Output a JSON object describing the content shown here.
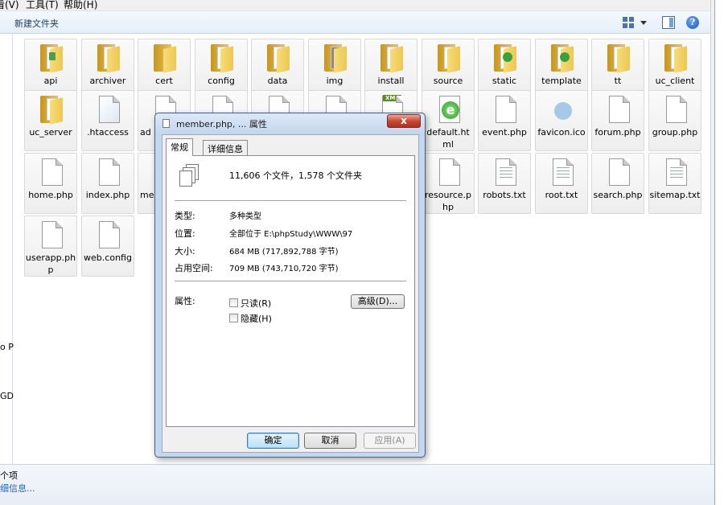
{
  "menubar": {
    "items": [
      {
        "label": "看(V)"
      },
      {
        "label": "工具(T)"
      },
      {
        "label": "帮助(H)"
      }
    ]
  },
  "toolbar": {
    "new_folder_label": "新建文件夹",
    "icons": [
      "views-icon",
      "preview-pane-icon",
      "help-icon"
    ],
    "help_glyph": "?"
  },
  "nav_fragments": [
    "o P",
    "GDL"
  ],
  "files": [
    {
      "name": "api",
      "type": "folder"
    },
    {
      "name": "archiver",
      "type": "folder"
    },
    {
      "name": "cert",
      "type": "folder"
    },
    {
      "name": "config",
      "type": "folder"
    },
    {
      "name": "data",
      "type": "folder"
    },
    {
      "name": "img",
      "type": "folder"
    },
    {
      "name": "install",
      "type": "folder"
    },
    {
      "name": "source",
      "type": "folder"
    },
    {
      "name": "static",
      "type": "folder-ie"
    },
    {
      "name": "template",
      "type": "folder-ie"
    },
    {
      "name": "tt",
      "type": "folder"
    },
    {
      "name": "uc_client",
      "type": "folder"
    },
    {
      "name": "uc_server",
      "type": "folder"
    },
    {
      "name": ".htaccess",
      "type": "doc"
    },
    {
      "name": "ad",
      "type": "doc"
    },
    {
      "name": "",
      "type": "doc"
    },
    {
      "name": "",
      "type": "doc"
    },
    {
      "name": "",
      "type": "doc"
    },
    {
      "name": "",
      "type": "xml"
    },
    {
      "name": "default.html",
      "type": "ie"
    },
    {
      "name": "event.php",
      "type": "doc"
    },
    {
      "name": "favicon.ico",
      "type": "ico"
    },
    {
      "name": "forum.php",
      "type": "doc"
    },
    {
      "name": "group.php",
      "type": "doc"
    },
    {
      "name": "home.php",
      "type": "doc"
    },
    {
      "name": "index.php",
      "type": "doc"
    },
    {
      "name": "me",
      "type": "doc"
    },
    {
      "name": "resource.php",
      "type": "doc"
    },
    {
      "name": "robots.txt",
      "type": "txt"
    },
    {
      "name": "root.txt",
      "type": "txt"
    },
    {
      "name": "search.php",
      "type": "doc"
    },
    {
      "name": "sitemap.txt",
      "type": "txt"
    },
    {
      "name": "userapp.php",
      "type": "doc"
    },
    {
      "name": "web.config",
      "type": "doc"
    }
  ],
  "dialog": {
    "title": "member.php, ... 属性",
    "close_glyph": "x",
    "tabs": [
      {
        "label": "常规"
      },
      {
        "label": "详细信息"
      }
    ],
    "summary": "11,606 个文件，1,578 个文件夹",
    "properties": [
      {
        "label": "类型:",
        "value": "多种类型"
      },
      {
        "label": "位置:",
        "value": "全部位于 E:\\phpStudy\\WWW\\97"
      },
      {
        "label": "大小:",
        "value": "684 MB (717,892,788 字节)"
      },
      {
        "label": "占用空间:",
        "value": "709 MB (743,710,720 字节)"
      }
    ],
    "attributes_label": "属性:",
    "attributes": [
      {
        "label": "只读(R)",
        "checked": false
      },
      {
        "label": "隐藏(H)",
        "checked": false
      }
    ],
    "advanced_button": "高级(D)...",
    "buttons": {
      "ok": "确定",
      "cancel": "取消",
      "apply": "应用(A)"
    }
  },
  "statusbar": {
    "count": "个项",
    "detail": "细信息..."
  }
}
